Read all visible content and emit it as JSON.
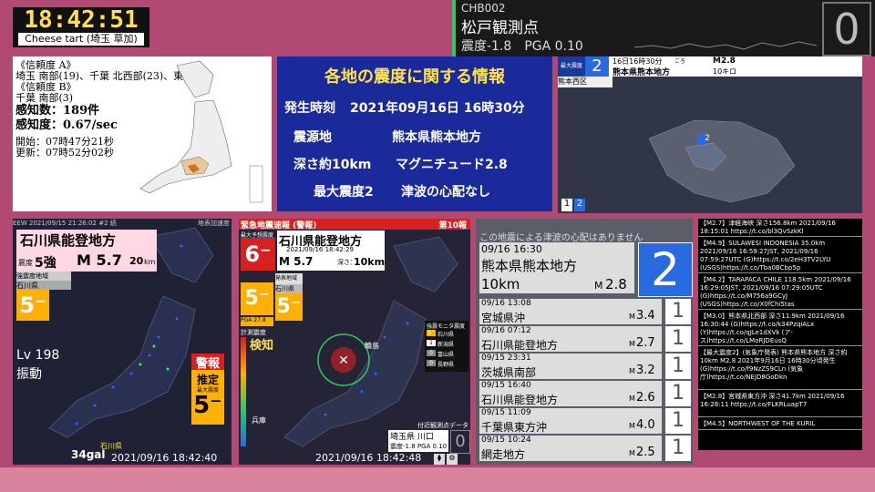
{
  "clock": {
    "time": "18:42:51",
    "stream_name": "Cheese tart (埼玉 草加)"
  },
  "station": {
    "code": "CHB002",
    "name": "松戸観測点",
    "values": "震度-1.8　PGA 0.10",
    "intensity": "0"
  },
  "detection": {
    "lines": [
      "《信頼度 A》",
      "埼玉 南部(19)、千葉 北西部(23)、東",
      "《信頼度 B》",
      "千葉 南部(3)"
    ],
    "count_label": "感知数：189件",
    "speed_label": "感知度：0.67/sec",
    "start": "開始：07時47分21秒",
    "update": "更新：07時52分02秒"
  },
  "info": {
    "title": "各地の震度に関する情報",
    "time_label": "発生時刻",
    "time_value": "2021年09月16日 16時30分",
    "epi_label": "震源地",
    "epi_value": "熊本県熊本地方",
    "depth_label": "深さ約10km",
    "mag_label": "マグニチュード2.8",
    "maxint_label": "最大震度2",
    "tsunami_label": "津波の心配なし"
  },
  "kumamoto": {
    "intensity": "2",
    "intensity_label": "最大震度",
    "time": "16日16時30分",
    "time_suffix": "ごろ",
    "mag": "M2.8",
    "place": "熊本県熊本地方",
    "depth": "10キロ",
    "area": "熊本西区",
    "legend": [
      "1",
      "2"
    ]
  },
  "eew1": {
    "header": "EEW 2021/09/15 21:26:02 #2 続",
    "header_right": "地表加速度",
    "region": "石川県能登地方",
    "shindo_label": "震度",
    "shindo": "5強",
    "mag": "M 5.7",
    "depth": "20",
    "depth_unit": "km",
    "strong_label": "強震度地域",
    "pref": "石川県",
    "pref_int": "5⁻",
    "lv": "Lv 198",
    "shake": "振動",
    "warn": "警報",
    "est": "推定",
    "est_sub": "最大震度",
    "est_int": "5⁻",
    "gal": "34gal",
    "datetime": "2021/09/16  18:42:40",
    "map_pref": "石川県"
  },
  "eew2": {
    "title": "緊急地震速報 (警報)",
    "report": "第10報",
    "maxint_label": "最大予想震度",
    "max_int": "6⁻",
    "region": "石川県能登地方",
    "origin": "2021/09/16 18:42:29",
    "mag": "M 5.7",
    "depth_label": "深さ：",
    "depth": "10km",
    "int_a": "5⁻",
    "int_b": "5⁻",
    "area_label": "発表地域",
    "area_pref": "石川県",
    "pga": "PGA 27.8",
    "meter": "計測震度",
    "detect": "検知",
    "monitor": "強震モニタ震度",
    "monitor_rows": [
      {
        "i": "5⁻",
        "n": "石川県"
      },
      {
        "i": "1",
        "n": "新潟県"
      },
      {
        "i": "0",
        "n": "富山県"
      },
      {
        "i": "0",
        "n": "長野県"
      }
    ],
    "station_label": "付近観測点データ",
    "station": "埼玉県 川口",
    "station_val": "震度-1.8 PGA 0.10",
    "station_int": "0",
    "datetime": "2021/09/16  18:42:48",
    "map_labels": [
      "輪島",
      "兵庫"
    ]
  },
  "qlist": {
    "banner": "この地震による津波の心配はありません",
    "top": {
      "time": "09/16 16:30",
      "place": "熊本県熊本地方",
      "depth": "10km",
      "mag_prefix": "M",
      "mag": "2.8",
      "int": "2"
    },
    "rows": [
      {
        "time": "09/16 13:08",
        "place": "宮城県沖",
        "mag_prefix": "M",
        "mag": "3.4",
        "int": "1"
      },
      {
        "time": "09/16 07:12",
        "place": "石川県能登地方",
        "mag_prefix": "M",
        "mag": "2.7",
        "int": "1"
      },
      {
        "time": "09/15 23:31",
        "place": "茨城県南部",
        "mag_prefix": "M",
        "mag": "3.2",
        "int": "1"
      },
      {
        "time": "09/15 16:40",
        "place": "石川県能登地方",
        "mag_prefix": "M",
        "mag": "2.6",
        "int": "1"
      },
      {
        "time": "09/15 11:09",
        "place": "千葉県東方沖",
        "mag_prefix": "M",
        "mag": "4.0",
        "int": "1"
      },
      {
        "time": "09/15 10:24",
        "place": "網走地方",
        "mag_prefix": "M",
        "mag": "2.5",
        "int": "1"
      }
    ]
  },
  "news": [
    "【M2.7】津軽海峡 深さ156.8km 2021/09/16 18:15:01 https://t.co/bl3QvSzkKl",
    "【M4.9】SULAWESI INDONESIA 35.0km 2021/09/16 16:59:27JST, 2021/09/16 07:59:27UTC (G)https://t.co/2eH3TV2LYU (USGS)https://t.co/Tba0BCbp5p",
    "【M4.2】TARAPACA CHILE 118.5km 2021/09/16 16:29:05JST, 2021/09/16 07:29:05UTC (G)https://t.co/M756a9GCyJ (USGS)https://t.co/X0fChi5tas",
    "【M3.0】熊本県北西部 深さ11.9km 2021/09/16 16:30:44 (G)https://t.co/k34PzqiALx (Y)https://t.co/qJLe1dXVk (ア-ス)https://t.co/LMoRJDEusQ",
    "【最大震度2】(気象庁発表) 熊本県熊本地方 深さ約10km M2.8 2021年9月16日 16時30分頃発生 (G)https://t.co/f9NzZS9CLn (気象庁)https://t.co/NEJD8GoDkn",
    "【M2.8】宮城県東方沖 深さ41.7km 2021/09/16 16:28:11 https://t.co/FLKRLuapT7",
    "【M4.5】NORTHWEST OF THE KURIL"
  ]
}
